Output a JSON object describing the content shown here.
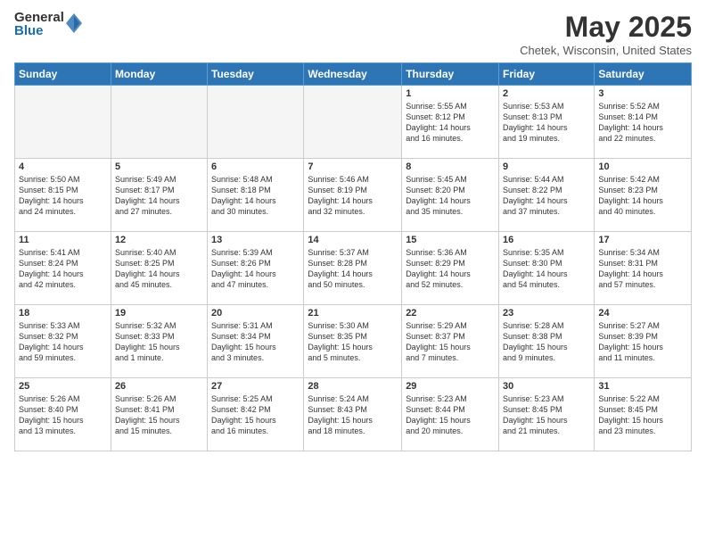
{
  "logo": {
    "general": "General",
    "blue": "Blue"
  },
  "title": "May 2025",
  "subtitle": "Chetek, Wisconsin, United States",
  "headers": [
    "Sunday",
    "Monday",
    "Tuesday",
    "Wednesday",
    "Thursday",
    "Friday",
    "Saturday"
  ],
  "weeks": [
    [
      {
        "day": "",
        "info": ""
      },
      {
        "day": "",
        "info": ""
      },
      {
        "day": "",
        "info": ""
      },
      {
        "day": "",
        "info": ""
      },
      {
        "day": "1",
        "info": "Sunrise: 5:55 AM\nSunset: 8:12 PM\nDaylight: 14 hours\nand 16 minutes."
      },
      {
        "day": "2",
        "info": "Sunrise: 5:53 AM\nSunset: 8:13 PM\nDaylight: 14 hours\nand 19 minutes."
      },
      {
        "day": "3",
        "info": "Sunrise: 5:52 AM\nSunset: 8:14 PM\nDaylight: 14 hours\nand 22 minutes."
      }
    ],
    [
      {
        "day": "4",
        "info": "Sunrise: 5:50 AM\nSunset: 8:15 PM\nDaylight: 14 hours\nand 24 minutes."
      },
      {
        "day": "5",
        "info": "Sunrise: 5:49 AM\nSunset: 8:17 PM\nDaylight: 14 hours\nand 27 minutes."
      },
      {
        "day": "6",
        "info": "Sunrise: 5:48 AM\nSunset: 8:18 PM\nDaylight: 14 hours\nand 30 minutes."
      },
      {
        "day": "7",
        "info": "Sunrise: 5:46 AM\nSunset: 8:19 PM\nDaylight: 14 hours\nand 32 minutes."
      },
      {
        "day": "8",
        "info": "Sunrise: 5:45 AM\nSunset: 8:20 PM\nDaylight: 14 hours\nand 35 minutes."
      },
      {
        "day": "9",
        "info": "Sunrise: 5:44 AM\nSunset: 8:22 PM\nDaylight: 14 hours\nand 37 minutes."
      },
      {
        "day": "10",
        "info": "Sunrise: 5:42 AM\nSunset: 8:23 PM\nDaylight: 14 hours\nand 40 minutes."
      }
    ],
    [
      {
        "day": "11",
        "info": "Sunrise: 5:41 AM\nSunset: 8:24 PM\nDaylight: 14 hours\nand 42 minutes."
      },
      {
        "day": "12",
        "info": "Sunrise: 5:40 AM\nSunset: 8:25 PM\nDaylight: 14 hours\nand 45 minutes."
      },
      {
        "day": "13",
        "info": "Sunrise: 5:39 AM\nSunset: 8:26 PM\nDaylight: 14 hours\nand 47 minutes."
      },
      {
        "day": "14",
        "info": "Sunrise: 5:37 AM\nSunset: 8:28 PM\nDaylight: 14 hours\nand 50 minutes."
      },
      {
        "day": "15",
        "info": "Sunrise: 5:36 AM\nSunset: 8:29 PM\nDaylight: 14 hours\nand 52 minutes."
      },
      {
        "day": "16",
        "info": "Sunrise: 5:35 AM\nSunset: 8:30 PM\nDaylight: 14 hours\nand 54 minutes."
      },
      {
        "day": "17",
        "info": "Sunrise: 5:34 AM\nSunset: 8:31 PM\nDaylight: 14 hours\nand 57 minutes."
      }
    ],
    [
      {
        "day": "18",
        "info": "Sunrise: 5:33 AM\nSunset: 8:32 PM\nDaylight: 14 hours\nand 59 minutes."
      },
      {
        "day": "19",
        "info": "Sunrise: 5:32 AM\nSunset: 8:33 PM\nDaylight: 15 hours\nand 1 minute."
      },
      {
        "day": "20",
        "info": "Sunrise: 5:31 AM\nSunset: 8:34 PM\nDaylight: 15 hours\nand 3 minutes."
      },
      {
        "day": "21",
        "info": "Sunrise: 5:30 AM\nSunset: 8:35 PM\nDaylight: 15 hours\nand 5 minutes."
      },
      {
        "day": "22",
        "info": "Sunrise: 5:29 AM\nSunset: 8:37 PM\nDaylight: 15 hours\nand 7 minutes."
      },
      {
        "day": "23",
        "info": "Sunrise: 5:28 AM\nSunset: 8:38 PM\nDaylight: 15 hours\nand 9 minutes."
      },
      {
        "day": "24",
        "info": "Sunrise: 5:27 AM\nSunset: 8:39 PM\nDaylight: 15 hours\nand 11 minutes."
      }
    ],
    [
      {
        "day": "25",
        "info": "Sunrise: 5:26 AM\nSunset: 8:40 PM\nDaylight: 15 hours\nand 13 minutes."
      },
      {
        "day": "26",
        "info": "Sunrise: 5:26 AM\nSunset: 8:41 PM\nDaylight: 15 hours\nand 15 minutes."
      },
      {
        "day": "27",
        "info": "Sunrise: 5:25 AM\nSunset: 8:42 PM\nDaylight: 15 hours\nand 16 minutes."
      },
      {
        "day": "28",
        "info": "Sunrise: 5:24 AM\nSunset: 8:43 PM\nDaylight: 15 hours\nand 18 minutes."
      },
      {
        "day": "29",
        "info": "Sunrise: 5:23 AM\nSunset: 8:44 PM\nDaylight: 15 hours\nand 20 minutes."
      },
      {
        "day": "30",
        "info": "Sunrise: 5:23 AM\nSunset: 8:45 PM\nDaylight: 15 hours\nand 21 minutes."
      },
      {
        "day": "31",
        "info": "Sunrise: 5:22 AM\nSunset: 8:45 PM\nDaylight: 15 hours\nand 23 minutes."
      }
    ]
  ]
}
